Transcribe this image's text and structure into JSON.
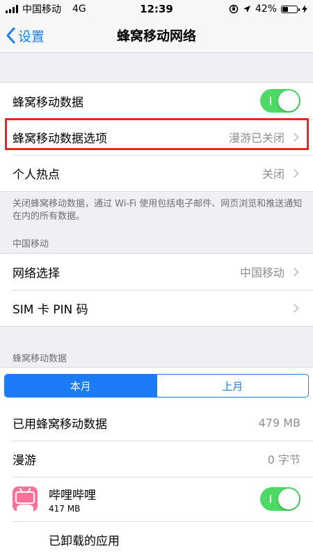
{
  "status_bar": {
    "carrier": "中国移动",
    "network": "4G",
    "time": "12:39",
    "battery": "42%",
    "battery_level": 0.42
  },
  "nav": {
    "back_label": "设置",
    "title": "蜂窝移动网络"
  },
  "group1": {
    "cellular_data_label": "蜂窝移动数据",
    "cellular_data_on": true,
    "options_label": "蜂窝移动数据选项",
    "options_value": "漫游已关闭",
    "hotspot_label": "个人热点",
    "hotspot_value": "关闭"
  },
  "footnote": "关闭蜂窝移动数据，通过 Wi-Fi 使用包括电子邮件、网页浏览和推送通知在内的所有数据。",
  "carrier_section": {
    "header": "中国移动",
    "network_select_label": "网络选择",
    "network_select_value": "中国移动",
    "sim_pin_label": "SIM 卡 PIN 码"
  },
  "usage_section": {
    "header": "蜂窝移动数据",
    "tabs": [
      "本月",
      "上月"
    ],
    "active_tab": 0,
    "used_label": "已用蜂窝移动数据",
    "used_value": "479 MB",
    "roaming_label": "漫游",
    "roaming_value": "0 字节",
    "app_name": "哔哩哔哩",
    "app_size": "417 MB",
    "app_enabled": true,
    "uninstalled_label": "已卸载的应用"
  },
  "colors": {
    "accent": "#1a7cf6",
    "toggle_on": "#4cd964",
    "highlight": "#ff1e1e",
    "app_icon": "#fb7299"
  }
}
